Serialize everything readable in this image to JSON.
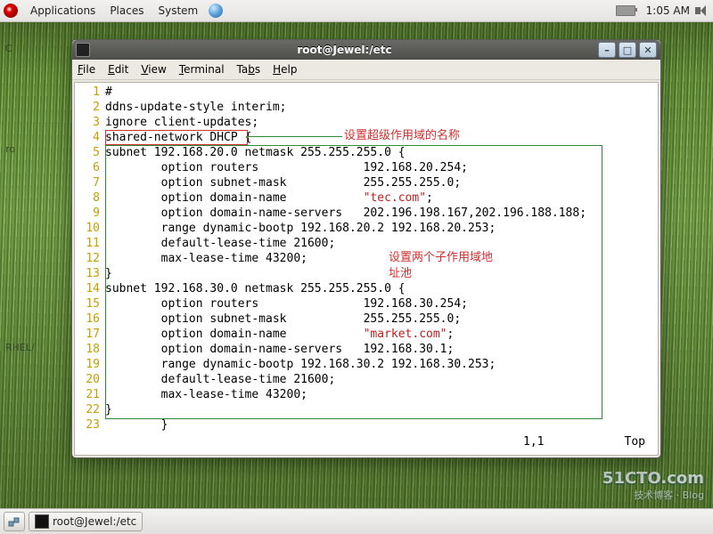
{
  "top_panel": {
    "menus": [
      "Applications",
      "Places",
      "System"
    ],
    "clock": "1:05 AM"
  },
  "bottom_panel": {
    "task_label": "root@Jewel:/etc"
  },
  "desktop_hints": {
    "a": "C",
    "b": "ro",
    "c": "RHEL/"
  },
  "window": {
    "title": "root@Jewel:/etc",
    "menu": {
      "file": "File",
      "edit": "Edit",
      "view": "View",
      "terminal": "Terminal",
      "tabs": "Tabs",
      "help": "Help"
    }
  },
  "editor": {
    "lines": [
      {
        "n": "1",
        "plain": "#"
      },
      {
        "n": "2",
        "plain": "ddns-update-style interim;"
      },
      {
        "n": "3",
        "plain": "ignore client-updates;"
      },
      {
        "n": "4",
        "plain": "shared-network DHCP {"
      },
      {
        "n": "5",
        "plain": "subnet 192.168.20.0 netmask 255.255.255.0 {"
      },
      {
        "n": "6",
        "plain": "        option routers               192.168.20.254;"
      },
      {
        "n": "7",
        "plain": "        option subnet-mask           255.255.255.0;"
      },
      {
        "n": "8",
        "pre": "        option domain-name           ",
        "str": "\"tec.com\"",
        "post": ";"
      },
      {
        "n": "9",
        "plain": "        option domain-name-servers   202.196.198.167,202.196.188.188;"
      },
      {
        "n": "10",
        "plain": "        range dynamic-bootp 192.168.20.2 192.168.20.253;"
      },
      {
        "n": "11",
        "plain": "        default-lease-time 21600;"
      },
      {
        "n": "12",
        "plain": "        max-lease-time 43200;"
      },
      {
        "n": "13",
        "plain": "}"
      },
      {
        "n": "14",
        "plain": "subnet 192.168.30.0 netmask 255.255.255.0 {"
      },
      {
        "n": "15",
        "plain": "        option routers               192.168.30.254;"
      },
      {
        "n": "16",
        "plain": "        option subnet-mask           255.255.255.0;"
      },
      {
        "n": "17",
        "pre": "        option domain-name           ",
        "str": "\"market.com\"",
        "post": ";"
      },
      {
        "n": "18",
        "plain": "        option domain-name-servers   192.168.30.1;"
      },
      {
        "n": "19",
        "plain": "        range dynamic-bootp 192.168.30.2 192.168.30.253;"
      },
      {
        "n": "20",
        "plain": "        default-lease-time 21600;"
      },
      {
        "n": "21",
        "plain": "        max-lease-time 43200;"
      },
      {
        "n": "22",
        "plain": "}"
      },
      {
        "n": "23",
        "plain": "        }"
      }
    ],
    "status": {
      "pos": "1,1",
      "scroll": "Top"
    }
  },
  "annotations": {
    "a1": "设置超级作用域的名称",
    "a2a": "设置两个子作用域地",
    "a2b": "址池"
  },
  "watermark": {
    "main": "51CTO.com",
    "sub": "技术博客 · Blog"
  }
}
